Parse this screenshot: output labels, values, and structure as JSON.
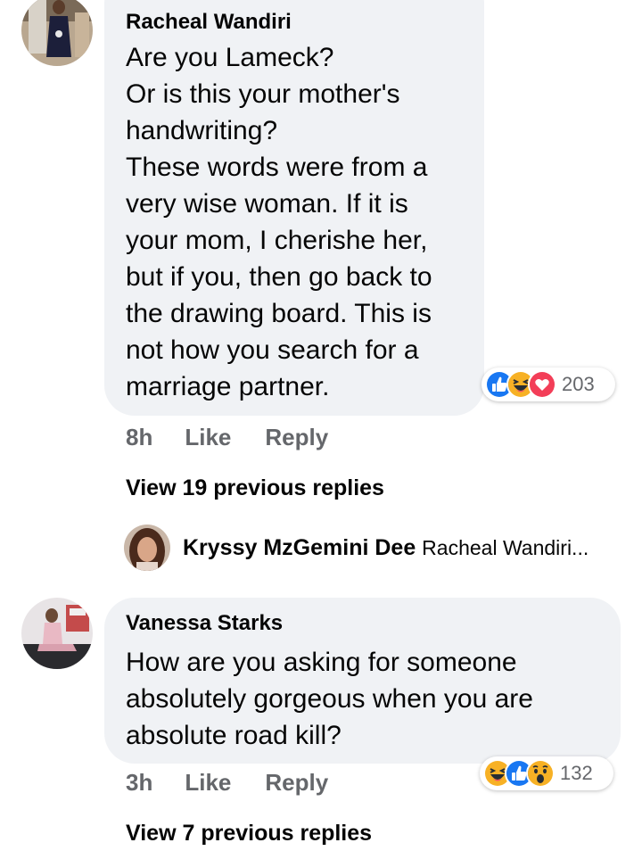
{
  "comments": [
    {
      "author": "Racheal Wandiri",
      "lines": [
        "Are you Lameck?",
        "Or is this your mother's",
        "handwriting?",
        "These words were from a",
        "very wise woman. If it is",
        "your mom, I cherishe her,",
        "but if you, then go back to",
        "the drawing board. This is",
        "not how you search for a",
        "marriage partner."
      ],
      "reactions": {
        "icons": [
          "like-icon",
          "haha-icon",
          "love-icon"
        ],
        "count": "203"
      },
      "time": "8h",
      "like_label": "Like",
      "reply_label": "Reply",
      "view_replies": "View 19 previous replies",
      "reply_preview": {
        "author": "Kryssy MzGemini Dee",
        "snippet": "Racheal Wandiri..."
      }
    },
    {
      "author": "Vanessa Starks",
      "lines": [
        "How are you asking for someone",
        "absolutely gorgeous when you are",
        "absolute road kill?"
      ],
      "reactions": {
        "icons": [
          "haha-icon",
          "like-icon",
          "wow-icon"
        ],
        "count": "132"
      },
      "time": "3h",
      "like_label": "Like",
      "reply_label": "Reply",
      "view_replies": "View 7 previous replies"
    }
  ],
  "colors": {
    "bubble": "#f0f2f5",
    "secondary_text": "#65676b",
    "like_blue": "#1877f2",
    "love_red": "#f33e58",
    "haha_yellow": "#f7b125"
  }
}
